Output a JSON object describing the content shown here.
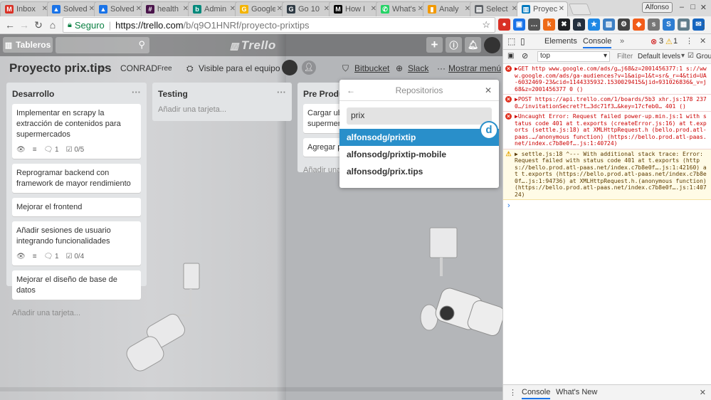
{
  "tabs": [
    {
      "label": "Inbox",
      "color": "#d93025",
      "glyph": "M"
    },
    {
      "label": "Solved",
      "color": "#1a73e8",
      "glyph": "▲"
    },
    {
      "label": "Solved",
      "color": "#1a73e8",
      "glyph": "▲"
    },
    {
      "label": "health",
      "color": "#4a154b",
      "glyph": "#"
    },
    {
      "label": "Admin",
      "color": "#00897b",
      "glyph": "b"
    },
    {
      "label": "Google",
      "color": "#f4b400",
      "glyph": "G"
    },
    {
      "label": "Go 10",
      "color": "#2f3b45",
      "glyph": "G"
    },
    {
      "label": "How I",
      "color": "#000000",
      "glyph": "M"
    },
    {
      "label": "What's",
      "color": "#25d366",
      "glyph": "✆"
    },
    {
      "label": "Analy",
      "color": "#f29900",
      "glyph": "▮"
    },
    {
      "label": "Select",
      "color": "#5f6368",
      "glyph": "▤"
    },
    {
      "label": "Proyec",
      "color": "#0079bf",
      "glyph": "▥"
    }
  ],
  "browser": {
    "user": "Alfonso",
    "secure_label": "Seguro",
    "url_host": "https://trello.com",
    "url_path": "/b/q9O1HNRf/proyecto-prixtips"
  },
  "extensions": [
    {
      "name": "extension-red-icon",
      "color": "#d93025",
      "glyph": "●"
    },
    {
      "name": "extension-docs-icon",
      "color": "#1a73e8",
      "glyph": "▣"
    },
    {
      "name": "extension-lastpass-icon",
      "color": "#555555",
      "glyph": "…"
    },
    {
      "name": "extension-k-icon",
      "color": "#ee6a17",
      "glyph": "k"
    },
    {
      "name": "extension-x-icon",
      "color": "#202124",
      "glyph": "✖"
    },
    {
      "name": "extension-amazon-icon",
      "color": "#232f3e",
      "glyph": "a"
    },
    {
      "name": "extension-star-icon",
      "color": "#1e88e5",
      "glyph": "★"
    },
    {
      "name": "extension-screen-icon",
      "color": "#3d7fc4",
      "glyph": "▨"
    },
    {
      "name": "extension-code-icon",
      "color": "#444444",
      "glyph": "⚙"
    },
    {
      "name": "extension-brave-icon",
      "color": "#f25c19",
      "glyph": "◆"
    },
    {
      "name": "extension-sub-icon",
      "color": "#777777",
      "glyph": "s"
    },
    {
      "name": "extension-s-icon",
      "color": "#2d7dd2",
      "glyph": "S"
    },
    {
      "name": "extension-cal-icon",
      "color": "#607d8b",
      "glyph": "▦"
    },
    {
      "name": "extension-mail-icon",
      "color": "#1565c0",
      "glyph": "✉"
    }
  ],
  "trello": {
    "boards_label": "Tableros",
    "logo": "Trello",
    "board_title": "Proyecto prix.tips",
    "team": "CONRAD",
    "plan": "Free",
    "visibility": "Visible para el equipo",
    "bitbucket": "Bitbucket",
    "slack": "Slack",
    "show_menu": "Mostrar menú",
    "lists": [
      {
        "title": "Desarrollo",
        "cards": [
          {
            "text": "Implementar en scrapy la extracción de contenidos para supermercados",
            "comments": "1",
            "checklist": "0/5"
          },
          {
            "text": "Reprogramar backend con framework de mayor rendimiento"
          },
          {
            "text": "Mejorar el frontend"
          },
          {
            "text": "Añadir sesiones de usuario integrando funcionalidades",
            "comments": "1",
            "checklist": "0/4"
          },
          {
            "text": "Mejorar el diseño de base de datos"
          }
        ],
        "add": "Añadir una tarjeta..."
      },
      {
        "title": "Testing",
        "cards": [],
        "add": "Añadir una tarjeta..."
      },
      {
        "title": "Pre Producción",
        "cards": [
          {
            "text": "Cargar ubicaciones de supermercados"
          },
          {
            "text": "Agregar pre"
          }
        ],
        "add": "Añadir una"
      }
    ]
  },
  "popover": {
    "title": "Repositorios",
    "search_value": "prix",
    "options": [
      "alfonsodg/prixtip",
      "alfonsodg/prixtip-mobile",
      "alfonsodg/prix.tips"
    ],
    "badge": "d"
  },
  "devtools": {
    "tabs": [
      "Elements",
      "Console"
    ],
    "errors": "3",
    "warnings": "1",
    "context": "top",
    "filter_placeholder": "Filter",
    "levels": "Default levels",
    "group_label": "Grou",
    "messages": [
      {
        "type": "error",
        "text": "▶GET http www.google.com/ads/g…j68&z=2001456377:1 s://www.google.com/ads/ga-audiences?v=1&aip=1&t=sr&_r=4&tid=UA-6032469-23&cid=1144335932.1530029415&jid=931026836&_v=j68&z=2001456377 0 ()"
      },
      {
        "type": "error",
        "text": "▶POST https://api.trello.com/1/boards/5b3 xhr.js:178 2370…/invitationSecret?t…3dc71f3…&key=17cfeb0… 401 ()"
      },
      {
        "type": "error",
        "text": "▶Uncaught Error: Request failed power-up.min.js:1 with status code 401 at t.exports (createError.js:16) at t.exports (settle.js:18) at XMLHttpRequest.h (bello.prod.atl-paas.…/anonymous function) (https://bello.prod.atl-paas.net/index.c7b8e0f….js:1:40724)"
      },
      {
        "type": "warn",
        "text": "▶ settle.js:18 ^--- With additional stack trace: Error: Request failed with status code 401 at t.exports (https://bello.prod.atl-paas.net/index.c7b8e0f….js:1:42160) at t.exports (https://bello.prod.atl-paas.net/index.c7b8e0f….js:1:94736) at XMLHttpRequest.h.(anonymous function) (https://bello.prod.atl-paas.net/index.c7b8e0f….js:1:40724)"
      }
    ],
    "drawer_tabs": [
      "Console",
      "What's New"
    ]
  }
}
